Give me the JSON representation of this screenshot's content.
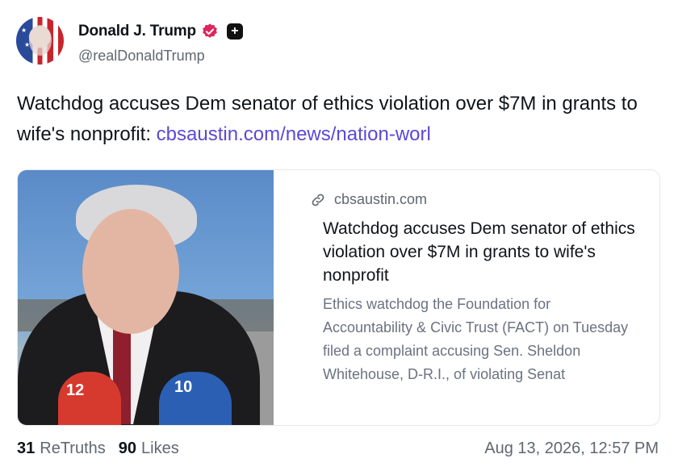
{
  "author": {
    "name": "Donald J. Trump",
    "handle": "@realDonaldTrump",
    "verified_icon": "verified-badge-icon",
    "plus_icon": "plus-badge-icon",
    "accent_color": "#e0245e"
  },
  "post": {
    "text": "Watchdog accuses Dem senator of ethics violation over $7M in grants to wife's nonprofit: ",
    "link_text": "cbsaustin.com/news/nation-worl",
    "link_color": "#5c48d6"
  },
  "card": {
    "domain": "cbsaustin.com",
    "title": "Watchdog accuses Dem senator of ethics violation over $7M in grants to wife's nonprofit",
    "description": "Ethics watchdog the Foundation for Accountability & Civic Trust (FACT) on Tuesday filed a complaint accusing Sen. Sheldon Whitehouse, D-R.I., of violating Senat",
    "image_mic1_text": "12",
    "image_mic2_text": "10"
  },
  "stats": {
    "retruths_count": "31",
    "retruths_label": "ReTruths",
    "likes_count": "90",
    "likes_label": "Likes",
    "timestamp": "Aug 13, 2026, 12:57 PM"
  }
}
